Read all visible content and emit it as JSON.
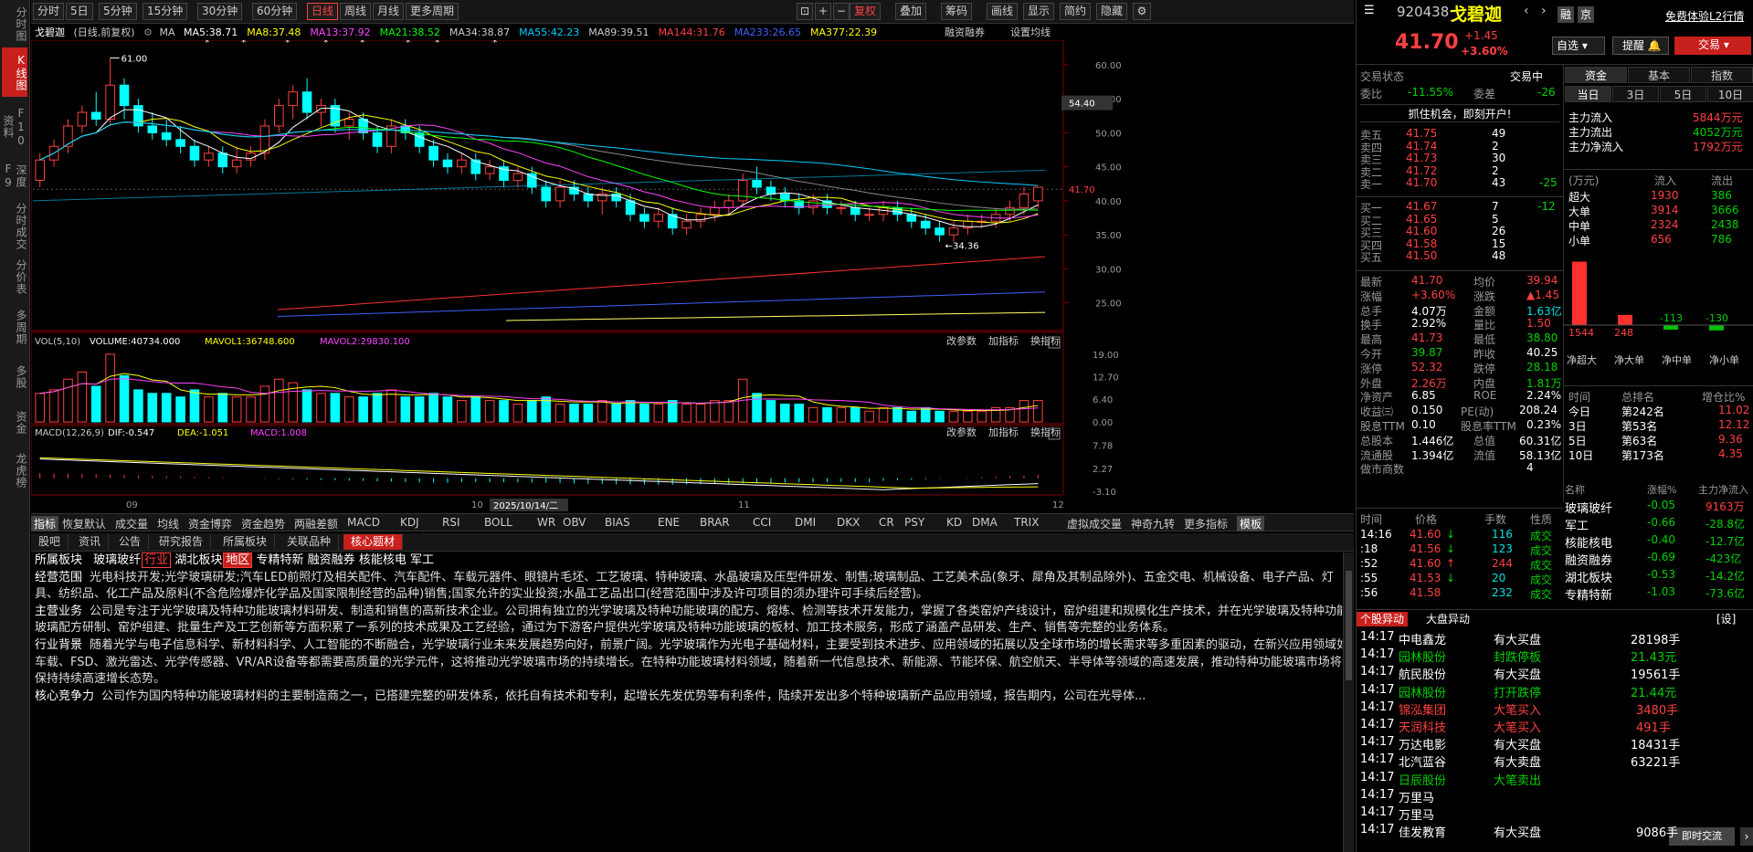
{
  "sidebar": [
    "分时图",
    "K线图",
    "F10资料",
    "深度F9",
    "分时成交",
    "分价表",
    "多周期",
    "多股",
    "资金",
    "龙虎榜"
  ],
  "toolbar": {
    "periods": [
      "分时",
      "5日",
      "5分钟",
      "15分钟",
      "30分钟",
      "60分钟",
      "日线",
      "周线",
      "月线",
      "更多周期"
    ],
    "right_buttons": [
      "复权",
      "叠加",
      "筹码",
      "画线",
      "显示",
      "简约",
      "隐藏"
    ],
    "icons": [
      "⊡",
      "+",
      "−"
    ]
  },
  "ma_bar": {
    "name": "戈碧迦",
    "mode": "(日线,前复权)",
    "items": [
      {
        "label": "MA5:38.71",
        "color": "#ffffff"
      },
      {
        "label": "MA8:37.48",
        "color": "#ffff00"
      },
      {
        "label": "MA13:37.92",
        "color": "#ff44ff"
      },
      {
        "label": "MA21:38.52",
        "color": "#00ff00"
      },
      {
        "label": "MA34:38.87",
        "color": "#cccccc"
      },
      {
        "label": "MA55:42.23",
        "color": "#00ccff"
      },
      {
        "label": "MA89:39.51",
        "color": "#cccccc"
      },
      {
        "label": "MA144:31.76",
        "color": "#ff4040"
      },
      {
        "label": "MA233:26.65",
        "color": "#4060ff"
      },
      {
        "label": "MA377:22.39",
        "color": "#ffff00"
      }
    ],
    "right": [
      "融资融券",
      "设置均线"
    ]
  },
  "chart": {
    "y_ticks": [
      "60.00",
      "55.00",
      "50.00",
      "45.00",
      "40.00",
      "35.00",
      "30.00",
      "25.00"
    ],
    "max_label": "61.00",
    "min_label": "34.36",
    "price_54": "54.40",
    "price_cur": "41.70",
    "x_labels": [
      "09",
      "10",
      "11",
      "12"
    ],
    "cursor_date": "2025/10/14/二"
  },
  "vol": {
    "title": "VOL(5,10)",
    "volume": "VOLUME:40734.000",
    "mavol1": "MAVOL1:36748.600",
    "mavol2": "MAVOL2:29830.100",
    "ticks": [
      "19.00",
      "12.70",
      "6.40",
      "0.00"
    ],
    "btns": [
      "改参数",
      "加指标",
      "换指标"
    ]
  },
  "macd": {
    "title": "MACD(12,26,9)",
    "dif": "DIF:-0.547",
    "dea": "DEA:-1.051",
    "macd": "MACD:1.008",
    "ticks": [
      "7.78",
      "2.27",
      "-3.10"
    ],
    "btns": [
      "改参数",
      "加指标",
      "换指标"
    ]
  },
  "indicator_tabs": [
    "指标",
    "恢复默认",
    "成交量",
    "均线",
    "资金博弈",
    "资金趋势",
    "两融差额",
    "MACD",
    "KDJ",
    "RSI",
    "BOLL",
    "WR",
    "OBV",
    "BIAS",
    "ENE",
    "BRAR",
    "CCI",
    "DMI",
    "DKX",
    "CR",
    "PSY",
    "KD",
    "DMA",
    "TRIX",
    "虚拟成交量",
    "神奇九转",
    "更多指标",
    "模板"
  ],
  "info_tabs": [
    "股吧",
    "资讯",
    "公告",
    "研究报告",
    "所属板块",
    "关联品种",
    "核心题材"
  ],
  "info": {
    "sector_label": "所属板块",
    "sectors": [
      "玻璃玻纤",
      "行业",
      "湖北板块",
      "地区",
      "专精特新",
      "融资融券",
      "核能核电",
      "军工"
    ],
    "scope_label": "经营范围",
    "scope": "光电科技开发;光学玻璃研发;汽车LED前照灯及相关配件、汽车配件、车载元器件、眼镜片毛坯、工艺玻璃、特种玻璃、水晶玻璃及压型件研发、制售;玻璃制品、工艺美术品(象牙、犀角及其制品除外)、五金交电、机械设备、电子产品、灯具、纺织品、化工产品及原料(不含危险爆炸化学品及国家限制经营的品种)销售;国家允许的实业投资;水晶工艺品出口(经营范围中涉及许可项目的须办理许可手续后经营)。",
    "main_label": "主营业务",
    "main": "公司是专注于光学玻璃及特种功能玻璃材料研发、制造和销售的高新技术企业。公司拥有独立的光学玻璃及特种功能玻璃的配方、熔炼、检测等技术开发能力，掌握了各类窑炉产线设计，窑炉组建和规模化生产技术，并在光学玻璃及特种功能玻璃配方研制、窑炉组建、批量生产及工艺创新等方面积累了一系列的技术成果及工艺经验，通过为下游客户提供光学玻璃及特种功能玻璃的板材、加工技术服务，形成了涵盖产品研发、生产、销售等完整的业务体系。",
    "bg_label": "行业背景",
    "bg": "随着光学与电子信息科学、新材料科学、人工智能的不断融合，光学玻璃行业未来发展趋势向好，前景广阔。光学玻璃作为光电子基础材料，主要受到技术进步、应用领域的拓展以及全球市场的增长需求等多重因素的驱动，在新兴应用领域如车载、FSD、激光雷达、光学传感器、VR/AR设备等都需要高质量的光学元件，这将推动光学玻璃市场的持续增长。在特种功能玻璃材料领域，随着新一代信息技术、新能源、节能环保、航空航天、半导体等领域的高速发展，推动特种功能玻璃市场将会保持持续高速增长态势。",
    "core_label": "核心竞争力",
    "core": "公司作为国内特种功能玻璃材料的主要制造商之一，已搭建完整的研发体系，依托自有技术和专利，起增长先发优势等有利条件，陆续开发出多个特种玻璃新产品应用领域，报告期内，公司在光导体..."
  },
  "quote": {
    "code": "920438",
    "name": "戈碧迦",
    "price": "41.70",
    "chg": "+1.45",
    "pct": "+3.60%",
    "btn_rong": "融",
    "btn_quan": "京",
    "free_l2": "免费体验L2行情",
    "zixuan": "自选",
    "tixing": "提醒",
    "jiaoyi": "交易",
    "state_label": "交易状态",
    "state": "交易中",
    "weibi_label": "委比",
    "weibi": "-11.55%",
    "weicha_label": "委差",
    "weicha": "-26",
    "promo": "抓住机会，即刻开户!"
  },
  "sells": [
    {
      "l": "卖五",
      "p": "41.75",
      "v": "49",
      "d": ""
    },
    {
      "l": "卖四",
      "p": "41.74",
      "v": "2",
      "d": ""
    },
    {
      "l": "卖三",
      "p": "41.73",
      "v": "30",
      "d": ""
    },
    {
      "l": "卖二",
      "p": "41.72",
      "v": "2",
      "d": ""
    },
    {
      "l": "卖一",
      "p": "41.70",
      "v": "43",
      "d": "-25"
    }
  ],
  "buys": [
    {
      "l": "买一",
      "p": "41.67",
      "v": "7",
      "d": "-12"
    },
    {
      "l": "买二",
      "p": "41.65",
      "v": "5",
      "d": ""
    },
    {
      "l": "买三",
      "p": "41.60",
      "v": "26",
      "d": ""
    },
    {
      "l": "买四",
      "p": "41.58",
      "v": "15",
      "d": ""
    },
    {
      "l": "买五",
      "p": "41.50",
      "v": "48",
      "d": ""
    }
  ],
  "stats": [
    [
      "最新",
      "41.70",
      "up",
      "均价",
      "39.94",
      "up"
    ],
    [
      "涨幅",
      "+3.60%",
      "up",
      "涨跌",
      "▲1.45",
      "up"
    ],
    [
      "总手",
      "4.07万",
      "wt",
      "金额",
      "1.63亿",
      "cy"
    ],
    [
      "换手",
      "2.92%",
      "wt",
      "量比",
      "1.50",
      "up"
    ],
    [
      "最高",
      "41.73",
      "up",
      "最低",
      "38.80",
      "dn"
    ],
    [
      "今开",
      "39.87",
      "dn",
      "昨收",
      "40.25",
      "wt"
    ],
    [
      "涨停",
      "52.32",
      "up",
      "跌停",
      "28.18",
      "dn"
    ],
    [
      "外盘",
      "2.26万",
      "up",
      "内盘",
      "1.81万",
      "dn"
    ],
    [
      "净资产",
      "6.85",
      "wt",
      "ROE",
      "2.24%",
      "wt"
    ],
    [
      "收益㈢",
      "0.150",
      "wt",
      "PE(动)",
      "208.24",
      "wt"
    ],
    [
      "股息TTM",
      "0.10",
      "wt",
      "股息率TTM",
      "0.23%",
      "wt"
    ],
    [
      "总股本",
      "1.446亿",
      "wt",
      "总值",
      "60.31亿",
      "wt"
    ],
    [
      "流通股",
      "1.394亿",
      "wt",
      "流值",
      "58.13亿",
      "wt"
    ],
    [
      "做市商数",
      "",
      "wt",
      "",
      "4",
      "wt"
    ]
  ],
  "ticks_header": [
    "时间",
    "价格",
    "手数",
    "性质"
  ],
  "ticks": [
    [
      "14:16",
      "41.60",
      "↓",
      "116",
      "成交"
    ],
    [
      ":18",
      "41.56",
      "↓",
      "123",
      "成交"
    ],
    [
      ":52",
      "41.60",
      "↑",
      "244",
      "成交"
    ],
    [
      ":55",
      "41.53",
      "↓",
      "20",
      "成交"
    ],
    [
      ":56",
      "41.58",
      "",
      "232",
      "成交"
    ]
  ],
  "fund_tabs": [
    "资金",
    "基本",
    "指数"
  ],
  "fund_subtabs": [
    "当日",
    "3日",
    "5日",
    "10日"
  ],
  "fund_flow": [
    [
      "主力流入",
      "5844万元"
    ],
    [
      "主力流出",
      "4052万元"
    ],
    [
      "主力净流入",
      "1792万元"
    ]
  ],
  "fund_table_header": [
    "(万元)",
    "流入",
    "流出"
  ],
  "fund_table": [
    [
      "超大",
      "1930",
      "386"
    ],
    [
      "大单",
      "3914",
      "3666"
    ],
    [
      "中单",
      "2324",
      "2438"
    ],
    [
      "小单",
      "656",
      "786"
    ]
  ],
  "fund_bars": {
    "values": [
      1544,
      248,
      -113,
      -130
    ],
    "labels": [
      "1544",
      "248",
      "-113",
      "-130"
    ],
    "cats": [
      "净超大",
      "净大单",
      "净中单",
      "净小单"
    ]
  },
  "rank_header": [
    "时间",
    "总排名",
    "增仓比%"
  ],
  "rank": [
    [
      "今日",
      "第242名",
      "11.02"
    ],
    [
      "3日",
      "第53名",
      "12.12"
    ],
    [
      "5日",
      "第63名",
      "9.36"
    ],
    [
      "10日",
      "第173名",
      "4.35"
    ]
  ],
  "sector_header": [
    "名称",
    "涨幅%",
    "主力净流入"
  ],
  "sector_rows": [
    [
      "玻璃玻纤",
      "-0.05",
      "9163万",
      "dn",
      "up"
    ],
    [
      "军工",
      "-0.66",
      "-28.8亿",
      "dn",
      "dn"
    ],
    [
      "核能核电",
      "-0.40",
      "-12.7亿",
      "dn",
      "dn"
    ],
    [
      "融资融券",
      "-0.69",
      "-423亿",
      "dn",
      "dn"
    ],
    [
      "湖北板块",
      "-0.53",
      "-14.2亿",
      "dn",
      "dn"
    ],
    [
      "专精特新",
      "-1.03",
      "-73.6亿",
      "dn",
      "dn"
    ]
  ],
  "alert_tabs": [
    "个股异动",
    "大盘异动",
    "[设]"
  ],
  "alerts": [
    [
      "14:17",
      "中电鑫龙",
      "有大买盘",
      "28198手",
      "wt"
    ],
    [
      "14:17",
      "园林股份",
      "封跌停板",
      "21.43元",
      "dn"
    ],
    [
      "14:17",
      "航民股份",
      "有大买盘",
      "19561手",
      "wt"
    ],
    [
      "14:17",
      "园林股份",
      "打开跌停",
      "21.44元",
      "dn"
    ],
    [
      "14:17",
      "锦泓集团",
      "大笔买入",
      "3480手",
      "up"
    ],
    [
      "14:17",
      "天润科技",
      "大笔买入",
      "491手",
      "up"
    ],
    [
      "14:17",
      "万达电影",
      "有大买盘",
      "18431手",
      "wt"
    ],
    [
      "14:17",
      "北汽蓝谷",
      "有大卖盘",
      "63221手",
      "wt"
    ],
    [
      "14:17",
      "日辰股份",
      "大笔卖出",
      "",
      "dn"
    ],
    [
      "14:17",
      "万里马",
      "",
      "",
      ""
    ],
    [
      "14:17",
      "万里马",
      "",
      "",
      ""
    ],
    [
      "14:17",
      "佳发教育",
      "有大买盘",
      "9086手",
      "wt"
    ]
  ],
  "chat_btn": "即时交流",
  "chart_data": {
    "type": "candlestick",
    "x": [
      "09",
      "10",
      "11",
      "12"
    ],
    "ylim": [
      22,
      62
    ],
    "candles": [
      [
        43,
        47,
        42,
        46
      ],
      [
        46,
        49,
        45,
        48
      ],
      [
        48,
        52,
        47,
        51
      ],
      [
        51,
        54,
        50,
        53
      ],
      [
        53,
        56,
        51,
        52
      ],
      [
        52,
        61,
        51,
        57
      ],
      [
        57,
        58,
        52,
        54
      ],
      [
        54,
        55,
        50,
        51
      ],
      [
        51,
        53,
        49,
        50
      ],
      [
        50,
        52,
        48,
        49
      ],
      [
        49,
        51,
        47,
        48
      ],
      [
        48,
        49,
        45,
        46
      ],
      [
        46,
        48,
        45,
        47
      ],
      [
        47,
        48,
        44,
        45
      ],
      [
        45,
        48,
        44,
        46
      ],
      [
        46,
        48,
        45,
        47
      ],
      [
        47,
        52,
        46,
        51
      ],
      [
        51,
        55,
        50,
        54
      ],
      [
        54,
        57,
        52,
        56
      ],
      [
        56,
        58,
        52,
        53
      ],
      [
        53,
        55,
        51,
        54
      ],
      [
        54,
        55,
        50,
        51
      ],
      [
        51,
        53,
        49,
        52
      ],
      [
        52,
        53,
        49,
        50
      ],
      [
        50,
        51,
        47,
        48
      ],
      [
        48,
        52,
        47,
        51
      ],
      [
        51,
        52,
        49,
        50
      ],
      [
        50,
        51,
        47,
        48
      ],
      [
        48,
        49,
        45,
        46
      ],
      [
        46,
        47,
        44,
        45
      ],
      [
        45,
        47,
        44,
        46
      ],
      [
        46,
        47,
        43,
        44
      ],
      [
        44,
        46,
        43,
        45
      ],
      [
        45,
        46,
        42,
        43
      ],
      [
        43,
        45,
        42,
        44
      ],
      [
        44,
        45,
        41,
        42
      ],
      [
        42,
        43,
        39,
        40
      ],
      [
        40,
        43,
        39,
        42
      ],
      [
        42,
        43,
        40,
        41
      ],
      [
        41,
        42,
        39,
        40
      ],
      [
        40,
        42,
        38,
        41
      ],
      [
        41,
        42,
        39,
        40
      ],
      [
        40,
        41,
        37,
        38
      ],
      [
        38,
        39,
        36,
        37
      ],
      [
        37,
        39,
        36,
        38
      ],
      [
        38,
        39,
        35,
        36
      ],
      [
        36,
        38,
        35,
        37
      ],
      [
        37,
        39,
        36,
        38
      ],
      [
        38,
        40,
        37,
        39
      ],
      [
        39,
        41,
        38,
        40
      ],
      [
        40,
        44,
        39,
        43
      ],
      [
        43,
        45,
        41,
        42
      ],
      [
        42,
        43,
        40,
        41
      ],
      [
        41,
        42,
        39,
        40
      ],
      [
        40,
        41,
        38,
        39
      ],
      [
        39,
        41,
        38,
        40
      ],
      [
        40,
        41,
        38,
        39
      ],
      [
        39,
        40,
        38,
        39
      ],
      [
        39,
        40,
        37,
        38
      ],
      [
        38,
        39,
        37,
        38
      ],
      [
        38,
        40,
        37,
        39
      ],
      [
        39,
        40,
        37,
        38
      ],
      [
        38,
        39,
        36,
        37
      ],
      [
        37,
        38,
        35,
        36
      ],
      [
        36,
        37,
        34,
        35
      ],
      [
        35,
        37,
        34,
        36
      ],
      [
        36,
        38,
        35,
        37
      ],
      [
        37,
        38,
        36,
        37
      ],
      [
        37,
        39,
        36,
        38
      ],
      [
        38,
        40,
        37,
        39
      ],
      [
        39,
        42,
        38,
        41
      ],
      [
        40,
        42,
        39,
        42
      ]
    ],
    "volume": [
      8,
      9,
      12,
      14,
      10,
      19,
      13,
      9,
      8,
      8,
      7,
      9,
      7,
      8,
      7,
      7,
      10,
      12,
      11,
      9,
      8,
      8,
      7,
      7,
      8,
      9,
      7,
      7,
      8,
      7,
      6,
      7,
      6,
      6,
      5,
      6,
      7,
      5,
      5,
      5,
      6,
      5,
      6,
      5,
      5,
      6,
      5,
      5,
      6,
      6,
      12,
      8,
      6,
      5,
      5,
      4,
      4,
      4,
      4,
      3,
      4,
      4,
      3,
      4,
      3,
      3,
      3,
      3,
      4,
      4,
      6,
      6
    ]
  }
}
